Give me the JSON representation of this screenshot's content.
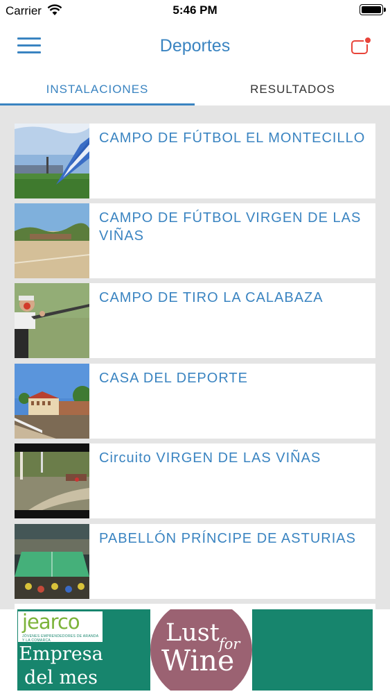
{
  "status_bar": {
    "carrier": "Carrier",
    "time": "5:46 PM"
  },
  "nav": {
    "title": "Deportes"
  },
  "tabs": [
    {
      "label": "INSTALACIONES",
      "active": true
    },
    {
      "label": "RESULTADOS",
      "active": false
    }
  ],
  "facilities": [
    {
      "name": "CAMPO DE FÚTBOL EL MONTECILLO",
      "thumbnail": "stadium-photo"
    },
    {
      "name": "CAMPO DE FÚTBOL VIRGEN DE LAS VIÑAS",
      "thumbnail": "dirt-field-photo"
    },
    {
      "name": "CAMPO DE TIRO LA CALABAZA",
      "thumbnail": "shooter-photo"
    },
    {
      "name": "CASA DEL DEPORTE",
      "thumbnail": "building-photo"
    },
    {
      "name": "Circuito VIRGEN DE LAS VIÑAS",
      "thumbnail": "trail-photo"
    },
    {
      "name": "PABELLÓN PRÍNCIPE DE ASTURIAS",
      "thumbnail": "arena-photo"
    }
  ],
  "ad": {
    "brand": "jearco",
    "brand_tagline": "JÓVENES EMPRENDEDORES DE ARANDA Y LA COMARCA",
    "headline": "Empresa del mes",
    "partner_lust": "Lust",
    "partner_for": "for",
    "partner_wine": "Wine"
  },
  "colors": {
    "accent": "#3a84c1",
    "notification": "#e8443a",
    "ad_green": "#17856d",
    "wine": "#9b6272"
  }
}
